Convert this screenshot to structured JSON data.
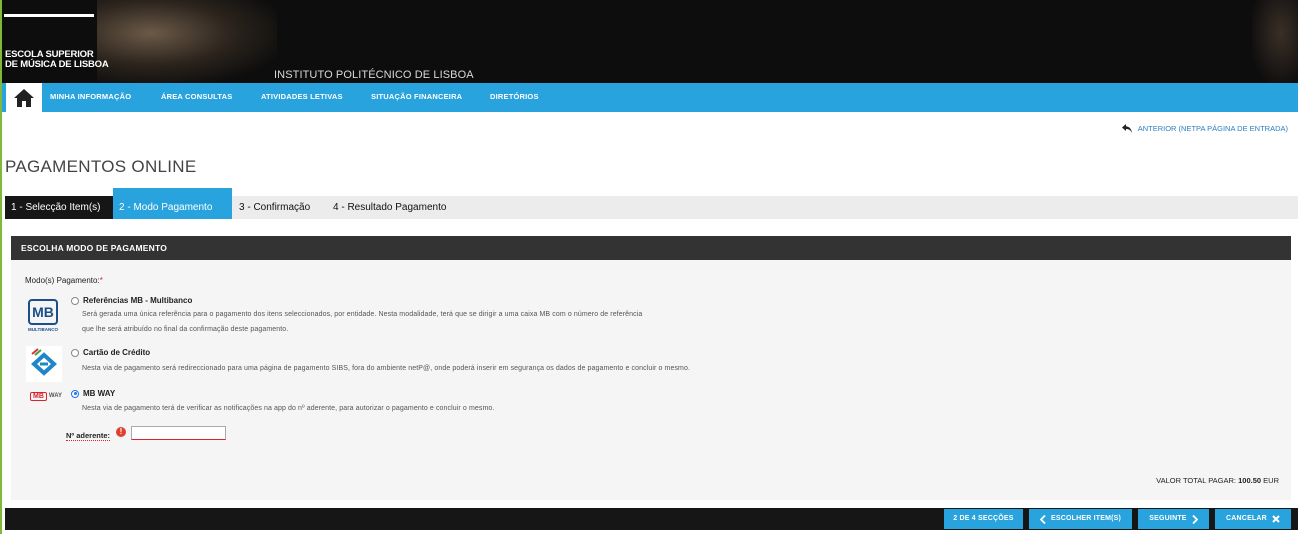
{
  "header": {
    "school_line1": "ESCOLA SUPERIOR",
    "school_line2": "DE MÚSICA DE LISBOA",
    "institute": "INSTITUTO POLITÉCNICO DE LISBOA"
  },
  "nav": {
    "items": [
      {
        "label": "MINHA INFORMAÇÃO"
      },
      {
        "label": "ÁREA CONSULTAS"
      },
      {
        "label": "ATIVIDADES LETIVAS"
      },
      {
        "label": "SITUAÇÃO FINANCEIRA"
      },
      {
        "label": "DIRETÓRIOS"
      }
    ]
  },
  "back_link": "ANTERIOR (NETPA PÁGINA DE ENTRADA)",
  "page_title": "PAGAMENTOS ONLINE",
  "steps": [
    {
      "label": "1 - Selecção Item(s)"
    },
    {
      "label": "2 - Modo Pagamento"
    },
    {
      "label": "3 - Confirmação"
    },
    {
      "label": "4 - Resultado Pagamento"
    }
  ],
  "panel": {
    "title": "ESCOLHA MODO DE PAGAMENTO",
    "modes_label": "Modo(s) Pagamento:",
    "required_mark": "*",
    "options": [
      {
        "title": "Referências MB - Multibanco",
        "desc1": "Será gerada uma única referência para o pagamento dos itens seleccionados, por entidade. Nesta modalidade, terá que se dirigir a uma caixa MB com o número de referência",
        "desc2": "que lhe será atribuído no final da confirmação deste pagamento.",
        "selected": false
      },
      {
        "title": "Cartão de Crédito",
        "desc1": "Nesta via de pagamento será redireccionado para uma página de pagamento SIBS, fora do ambiente netP@, onde poderá inserir em segurança os dados de pagamento e concluir o mesmo.",
        "selected": false
      },
      {
        "title": "MB WAY",
        "desc1": "Nesta via de pagamento terá de verificar as notificações na app do nº aderente, para autorizar o pagamento e concluir o mesmo.",
        "selected": true
      }
    ],
    "mb_logo": {
      "main": "MB",
      "sub": "MULTIBANCO"
    },
    "mbway_logo": {
      "main": "MB",
      "sub": "WAY"
    },
    "adherent_label": "Nº aderente:",
    "adherent_value": "",
    "warn_glyph": "!",
    "total_label": "VALOR TOTAL PAGAR:",
    "total_value": "100.50",
    "total_currency": "EUR"
  },
  "footer": {
    "section_counter": "2 DE 4 SECÇÕES",
    "prev_label": "ESCOLHER ITEM(S)",
    "next_label": "SEGUINTE",
    "cancel_label": "CANCELAR"
  },
  "colors": {
    "accent": "#29a3de",
    "dark": "#161616",
    "required": "#d9232e"
  },
  "icons": [
    "home-icon",
    "back-arrow-icon",
    "chevron-left-icon",
    "chevron-right-icon",
    "close-icon",
    "multibanco-logo",
    "sibs-card-logo",
    "mbway-logo",
    "warning-icon"
  ]
}
